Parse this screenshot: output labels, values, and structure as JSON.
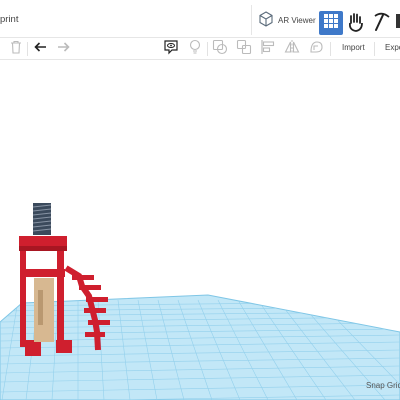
{
  "header": {
    "title": "print",
    "ar_viewer_label": "AR Viewer"
  },
  "toolbar": {
    "import_label": "Import",
    "export_label": "Expo"
  },
  "workplane": {
    "snap_grid_label": "Snap Grid"
  },
  "colors": {
    "accent": "#3f79c9",
    "grid_fill": "#bfe6f6",
    "grid_line": "#8fcfeb",
    "model_red": "#cf1f2e",
    "model_beige": "#d7b891",
    "model_dark": "#3b4a5c"
  }
}
